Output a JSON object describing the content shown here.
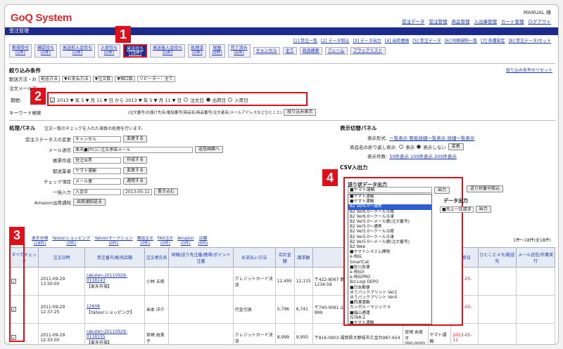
{
  "app": {
    "logo": "GoQ System",
    "user": "MANUAL 様"
  },
  "topnav": [
    "受注データ",
    "受注管理",
    "商品管理",
    "入出庫管理",
    "カート管理",
    "ログアウト"
  ],
  "bar_title": "受注管理",
  "sublinks": [
    "[1] 受注一覧",
    "[2] データ取込",
    "[3] データ出力",
    "[4] 出荷連絡",
    "[5] 受注データ",
    "[6] 同梱規則一覧",
    "[7] 各種設定",
    "[8] 受注データ/セット"
  ],
  "tabs": [
    {
      "l1": "新規受付",
      "l2": "(0件)"
    },
    {
      "l1": "確認待ち",
      "l2": "(0件)"
    },
    {
      "l1": "発送前入金待ち",
      "l2": "(0件)"
    },
    {
      "l1": "入荷待ち",
      "l2": "(0件)"
    },
    {
      "l1": "発送待ち",
      "l2": "(18件)",
      "selected": true
    },
    {
      "l1": "発送後入金待ち",
      "l2": "(0件)"
    },
    {
      "l1": "処理済",
      "l2": "(0件)"
    },
    {
      "l1": "保留",
      "l2": "(0件)"
    },
    {
      "l1": "完了済み",
      "l2": "(0件)"
    }
  ],
  "tabs_plain": [
    "キャンセル",
    "全て",
    "商品検索",
    "クレーム",
    "ブラックリスト"
  ],
  "filter": {
    "title": "絞り込み条件",
    "reset": "絞り込み条件のリセット",
    "label1": "配送方法・お",
    "v1": "配送方法",
    "v2": "▼お支払方法",
    "v3": "▼注文数",
    "v4": "▼個口数",
    "v5": "リピーター：全て",
    "label2": "注文メールア",
    "period_label": "期間:",
    "period_text": "2013 ▼ 年 5 ▼ 月 11 ▼ 日 から 2013 ▼ 年 5 ▼ 月 11 ▼ 日",
    "r1": "注文日",
    "r2": "出荷日",
    "r3": "入荷日",
    "kw_label": "キーワード検索",
    "kw_note": "(注文番号/お届け先名/電話番号/商品名/商品番号/注文者名/メールアドレスなどひとこと)",
    "search_btn": "絞り込み表示"
  },
  "panel": {
    "title": "処理パネル",
    "note": "注文一覧のチェックを入れた項目の処理を行います。",
    "status_label": "受注ステータスの変更",
    "status_val": "キャンセル",
    "change_btn": "変更する",
    "mail_label": "メール送信",
    "mail_val": "楽天■[PC]ご注文承諾メール",
    "mail_btn": "送信画面へ",
    "ship_label": "帳票作成",
    "ship_val": "受注伝票",
    "make_btn": "作成する",
    "carrier_label": "配送業者",
    "carrier_val": "ヤマト運輸",
    "change_btn2": "変更する",
    "check_label": "チェック項目",
    "check_val": "メール便",
    "apply_btn": "適用する",
    "bulk_label": "一括入力",
    "bulk_val": "入金日",
    "bulk_date": "2013-05-11",
    "write_btn": "書き込む",
    "amazon_label": "Amazon出荷通知",
    "amazon_btn": "出荷通知送る"
  },
  "display": {
    "title": "表示切替パネル",
    "l1": "表示形式:",
    "v1": "一覧表示 簡易詳細一覧表示 詳細一覧表示",
    "l2": "商品名の折り返し表示:",
    "r1": "表示",
    "r2": "表示しない",
    "btn": "変更",
    "l3": "表示件数:",
    "v3": "50件表示 100件表示 200件表示"
  },
  "csv": {
    "title": "CSV入出力",
    "popup_title": "送り状データ出力",
    "sel": "■ヤマト運輸",
    "out_btn": "出力",
    "import_btn": "送り状番号取込",
    "data_title": "データ出力",
    "sel2": "■売上一括請求",
    "out_btn2": "出力",
    "count": "1件～18件(全18件)"
  },
  "dropdown": [
    "■ヤマト運輸",
    "■ヤマト運輸",
    "B2 Ver6.0～通常",
    "B2 Ver6.0～クール冷蔵",
    "B2 Ver6.0～クール冷凍",
    "B2 Ver5.0～メール便(注文番号)",
    "B2 Ver5.0～通常",
    "B2 Ver5.0～クール冷蔵",
    "B2 Ver5.0～クール冷凍",
    "B2 Ver5.0～メール便(注文番号)",
    "B2 Web",
    "■ヤマトシステム開発",
    "e-飛伝",
    "SmartCat",
    "■佐川急便",
    "e-飛伝II",
    "e-飛伝PRO",
    "Biz-Logi DEPO",
    "■日本郵便",
    "ゆうパックプリント Ver2",
    "ゆうパックプリント Ver4",
    "■西濃運輸",
    "カンガルーマジック II",
    "■福山通運",
    "ISTAR-2",
    "■ヤマト運輸"
  ],
  "channels": [
    {
      "l1": "楽天市場",
      "l2": "(18件)"
    },
    {
      "l1": "Yahoo!ショッピング",
      "l2": "(0件)"
    },
    {
      "l1": "Yahoo!オークション",
      "l2": "(0件)"
    },
    {
      "l1": "電話注文",
      "l2": "(0件)"
    },
    {
      "l1": "FAX注文",
      "l2": "(0件)"
    },
    {
      "l1": "Amazon",
      "l2": "(0件)"
    },
    {
      "l1": "店舗",
      "l2": "(0件)"
    }
  ],
  "table": {
    "headers": [
      "すべてチェック",
      "注文日時",
      "受注番号/販売店舗",
      "注文者氏名",
      "同梱/送り先注番/携帯/ポイント注番",
      "お支払い方法",
      "合計金額",
      "請求額",
      "送り先住所",
      "送り先氏名",
      "入荷日",
      "出荷日",
      "ひとことメモ/配送先",
      "メール送信/作業実行"
    ],
    "rows": [
      {
        "date": "2011-09-29 13:50:00",
        "order": "rakuten-20110929-0118143",
        "shop": "【楽天市場】",
        "name": "小林 五郎",
        "pay": "クレジットカード決済",
        "total": "12,495",
        "bill": "12,115",
        "addr": "〒422-8067 静岡県静岡市駿河区聖一色1234-56",
        "to": "小林 五郎",
        "phone": "090-0000",
        "ship": "2013-05-11"
      },
      {
        "date": "2011-09-29 12:37:25",
        "order": "12608",
        "shop": "【Yahoo!ショッピング】",
        "name": "米本 洋介",
        "pay": "代金引換",
        "total": "5,796",
        "bill": "6,741",
        "addr": "〒740-0061 山口県 岩国市中町 2-9 999-999",
        "to": "米本 洋介",
        "phone": "090-0000",
        "ship": "2013-05-11"
      },
      {
        "date": "2011-09-29 12:33:00",
        "order": "rakuten-20110929-0118155",
        "shop": "【楽天市場】",
        "name": "宮崎 由美子",
        "pay": "クレジットカード決済",
        "total": "8,999",
        "bill": "9,950",
        "addr": "〒816-0903 福岡県大野城市乙金台987-654",
        "to": "宮崎 由美子",
        "phone": "090-0000",
        "carrier": "ヤマト運輸",
        "ship": "2013-05-11"
      }
    ]
  },
  "callouts": [
    "1",
    "2",
    "3",
    "4"
  ],
  "colors": {
    "brand": "#d8272d",
    "navy": "#1b2a8c",
    "highlight": "#e0101a",
    "link": "#1a35a8"
  }
}
